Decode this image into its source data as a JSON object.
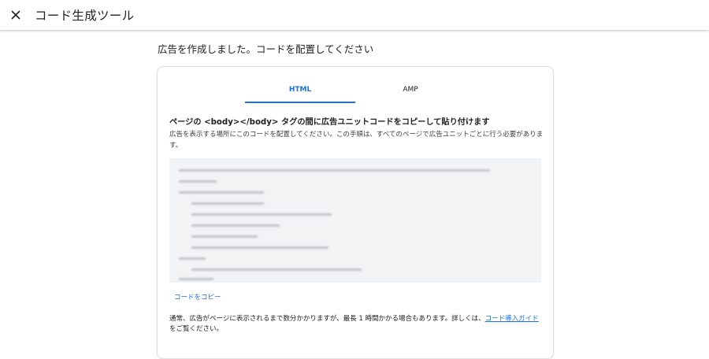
{
  "header": {
    "title": "コード生成ツール",
    "close_icon": "close-icon"
  },
  "main": {
    "heading": "広告を作成しました。コードを配置してください",
    "tabs": [
      {
        "label": "HTML",
        "selected": true
      },
      {
        "label": "AMP",
        "selected": false
      }
    ],
    "subheading": "ページの <body></body> タグの間に広告ユニットコードをコピーして貼り付けます",
    "description": "広告を表示する場所にこのコードを配置してください。この手順は、すべてのページで広告ユニットごとに行う必要があります。",
    "copy_label": "コードをコピー",
    "notice_text": "通常、広告がページに表示されるまで数分かかりますが、最長 1 時間かかる場合もあります。詳しくは、",
    "notice_link": "コード導入ガイド",
    "notice_suffix": "をご覧ください。"
  },
  "colors": {
    "accent": "#1a73e8",
    "code_bg": "#f1f3f4"
  }
}
